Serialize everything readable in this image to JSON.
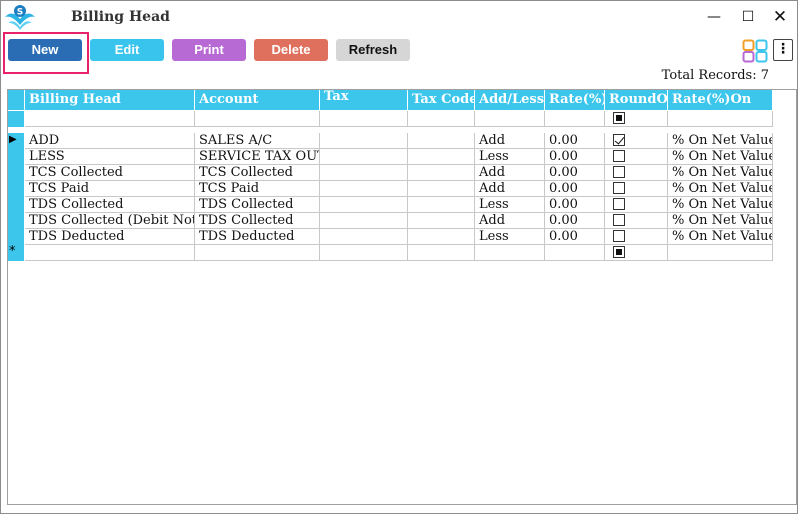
{
  "window": {
    "title": "Billing Head",
    "minimize_glyph": "—",
    "maximize_glyph": "☐",
    "close_glyph": "✕"
  },
  "toolbar": {
    "new_label": "New",
    "edit_label": "Edit",
    "print_label": "Print",
    "delete_label": "Delete",
    "refresh_label": "Refresh",
    "more_glyph": "⋮",
    "colors": {
      "new": "#2a6db5",
      "edit": "#38c4ec",
      "print": "#b86ad4",
      "delete": "#e0705e",
      "refresh": "#d6d6d6",
      "highlight": "#e8226a"
    }
  },
  "summary": {
    "total_records": "Total Records: 7"
  },
  "grid": {
    "header_color": "#3cc6ec",
    "columns": [
      "Billing Head",
      "Account",
      "Tax",
      "Tax Code",
      "Add/Less",
      "Rate(%)",
      "RoundOff",
      "Rate(%)On"
    ],
    "rows": [
      {
        "billing_head": "ADD",
        "account": "SALES A/C",
        "tax": "",
        "tax_code": "",
        "add_less": "Add",
        "rate": "0.00",
        "round_off": true,
        "rate_on": "% On Net Value"
      },
      {
        "billing_head": "LESS",
        "account": "SERVICE TAX OUT",
        "tax": "",
        "tax_code": "",
        "add_less": "Less",
        "rate": "0.00",
        "round_off": false,
        "rate_on": "% On Net Value"
      },
      {
        "billing_head": "TCS Collected",
        "account": "TCS Collected",
        "tax": "",
        "tax_code": "",
        "add_less": "Add",
        "rate": "0.00",
        "round_off": false,
        "rate_on": "% On Net Value"
      },
      {
        "billing_head": "TCS Paid",
        "account": "TCS Paid",
        "tax": "",
        "tax_code": "",
        "add_less": "Add",
        "rate": "0.00",
        "round_off": false,
        "rate_on": "% On Net Value"
      },
      {
        "billing_head": "TDS Collected",
        "account": "TDS Collected",
        "tax": "",
        "tax_code": "",
        "add_less": "Less",
        "rate": "0.00",
        "round_off": false,
        "rate_on": "% On Net Value"
      },
      {
        "billing_head": "TDS Collected (Debit Note)",
        "account": "TDS Collected",
        "tax": "",
        "tax_code": "",
        "add_less": "Add",
        "rate": "0.00",
        "round_off": false,
        "rate_on": "% On Net Value"
      },
      {
        "billing_head": "TDS Deducted",
        "account": "TDS Deducted",
        "tax": "",
        "tax_code": "",
        "add_less": "Less",
        "rate": "0.00",
        "round_off": false,
        "rate_on": "% On Net Value"
      }
    ],
    "current_row_glyph": "▶",
    "new_row_glyph": "*"
  }
}
